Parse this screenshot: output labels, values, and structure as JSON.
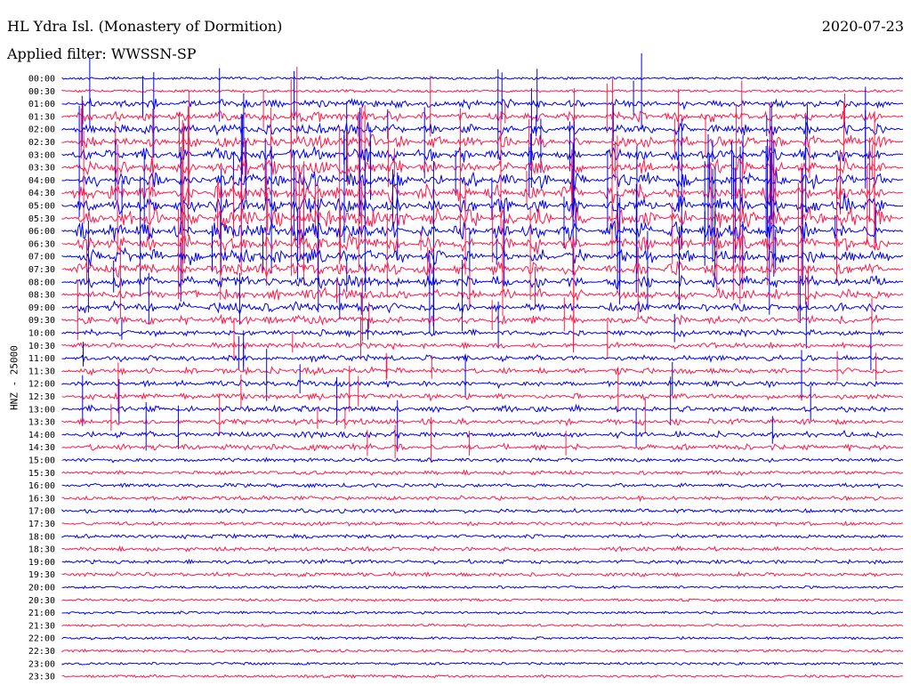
{
  "header": {
    "station": "HL Ydra Isl. (Monastery of Dormition)",
    "filter": "Applied filter: WWSSN-SP",
    "date": "2020-07-23"
  },
  "chart_data": {
    "type": "line",
    "ylabel": "HNZ - 25000",
    "row_labels": [
      "00:00",
      "00:30",
      "01:00",
      "01:30",
      "02:00",
      "02:30",
      "03:00",
      "03:30",
      "04:00",
      "04:30",
      "05:00",
      "05:30",
      "06:00",
      "06:30",
      "07:00",
      "07:30",
      "08:00",
      "08:30",
      "09:00",
      "09:30",
      "10:00",
      "10:30",
      "11:00",
      "11:30",
      "12:00",
      "12:30",
      "13:00",
      "13:30",
      "14:00",
      "14:30",
      "15:00",
      "15:30",
      "16:00",
      "16:30",
      "17:00",
      "17:30",
      "18:00",
      "18:30",
      "19:00",
      "19:30",
      "20:00",
      "20:30",
      "21:00",
      "21:30",
      "22:00",
      "22:30",
      "23:00",
      "23:30"
    ],
    "series_colors": [
      "#0000ee",
      "#ff1a4a"
    ],
    "grid": false
  }
}
